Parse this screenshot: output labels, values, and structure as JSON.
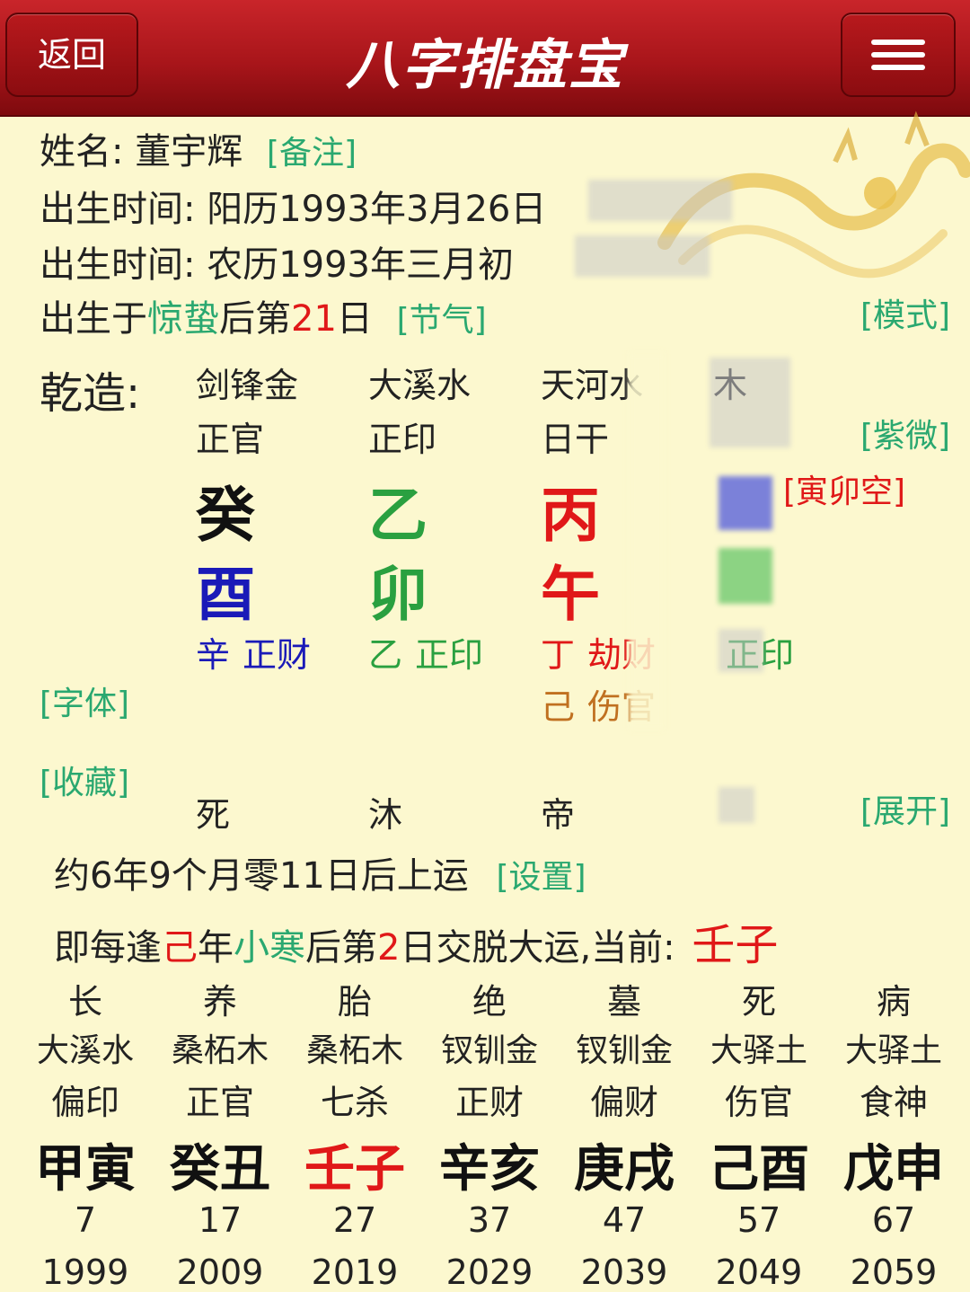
{
  "header": {
    "back_label": "返回",
    "title": "八字排盘宝",
    "menu_icon": "hamburger-menu-icon",
    "bg_color": "#b0161b"
  },
  "info": {
    "name_label": "姓名:",
    "name_value": "董宇辉",
    "remark_link": "[备注]",
    "solar_label": "出生时间:",
    "solar_value": "阳历1993年3月26日",
    "lunar_label": "出生时间:",
    "lunar_value": "农历1993年三月初",
    "born_prefix": "出生于",
    "solar_term": "惊蛰",
    "born_mid": "后第",
    "born_day": "21",
    "born_suffix": "日",
    "jieqi_link": "[节气]",
    "mode_link": "[模式]"
  },
  "chart": {
    "gender_label": "乾造:",
    "ziwei_link": "[紫微]",
    "kong_link": "[寅卯空]",
    "font_link": "[字体]",
    "favorite_link": "[收藏]",
    "expand_link": "[展开]",
    "columns": [
      {
        "nayin": "剑锋金",
        "shishen": "正官",
        "stem": "癸",
        "stem_color": "#111111",
        "branch": "酉",
        "branch_color": "#1a1ab8",
        "hidden1_char": "辛",
        "hidden1_god": "正财",
        "hidden1_color": "#1a1ab8",
        "hidden2_char": "",
        "hidden2_god": "",
        "hidden2_color": "#c07020",
        "stage": "死"
      },
      {
        "nayin": "大溪水",
        "shishen": "正印",
        "stem": "乙",
        "stem_color": "#2aa040",
        "branch": "卯",
        "branch_color": "#2aa040",
        "hidden1_char": "乙",
        "hidden1_god": "正印",
        "hidden1_color": "#2aa040",
        "hidden2_char": "",
        "hidden2_god": "",
        "hidden2_color": "#c07020",
        "stage": "沐"
      },
      {
        "nayin": "天河水",
        "shishen": "日干",
        "stem": "丙",
        "stem_color": "#e01818",
        "branch": "午",
        "branch_color": "#e01818",
        "hidden1_char": "丁",
        "hidden1_god": "劫财",
        "hidden1_color": "#e01818",
        "hidden2_char": "己",
        "hidden2_god": "伤官",
        "hidden2_color": "#c07020",
        "stage": "帝"
      },
      {
        "nayin": "木",
        "shishen": "",
        "stem": "",
        "stem_color": "#3a3ad0",
        "branch": "",
        "branch_color": "#2aa040",
        "hidden1_char": "",
        "hidden1_god": "正印",
        "hidden1_color": "#2aa040",
        "hidden2_char": "",
        "hidden2_god": "",
        "hidden2_color": "#c07020",
        "stage": ""
      }
    ]
  },
  "dayun": {
    "start_text": "约6年9个月零11日后上运",
    "settings_link": "[设置]",
    "line2_a": "即每逢",
    "line2_b": "己",
    "line2_c": "年",
    "line2_d": "小寒",
    "line2_e": "后第",
    "line2_f": "2",
    "line2_g": "日交脱大运,当前:",
    "current": "壬子",
    "pillars": [
      {
        "stage": "长",
        "nayin": "大溪水",
        "god": "偏印",
        "ganzhi": "甲寅",
        "color": "#111111",
        "age": "7",
        "year": "1999"
      },
      {
        "stage": "养",
        "nayin": "桑柘木",
        "god": "正官",
        "ganzhi": "癸丑",
        "color": "#111111",
        "age": "17",
        "year": "2009"
      },
      {
        "stage": "胎",
        "nayin": "桑柘木",
        "god": "七杀",
        "ganzhi": "壬子",
        "color": "#e01818",
        "age": "27",
        "year": "2019"
      },
      {
        "stage": "绝",
        "nayin": "钗钏金",
        "god": "正财",
        "ganzhi": "辛亥",
        "color": "#111111",
        "age": "37",
        "year": "2029"
      },
      {
        "stage": "墓",
        "nayin": "钗钏金",
        "god": "偏财",
        "ganzhi": "庚戌",
        "color": "#111111",
        "age": "47",
        "year": "2039"
      },
      {
        "stage": "死",
        "nayin": "大驿土",
        "god": "伤官",
        "ganzhi": "己酉",
        "color": "#111111",
        "age": "57",
        "year": "2049"
      },
      {
        "stage": "病",
        "nayin": "大驿土",
        "god": "食神",
        "ganzhi": "戊申",
        "color": "#111111",
        "age": "67",
        "year": "2059"
      }
    ]
  }
}
